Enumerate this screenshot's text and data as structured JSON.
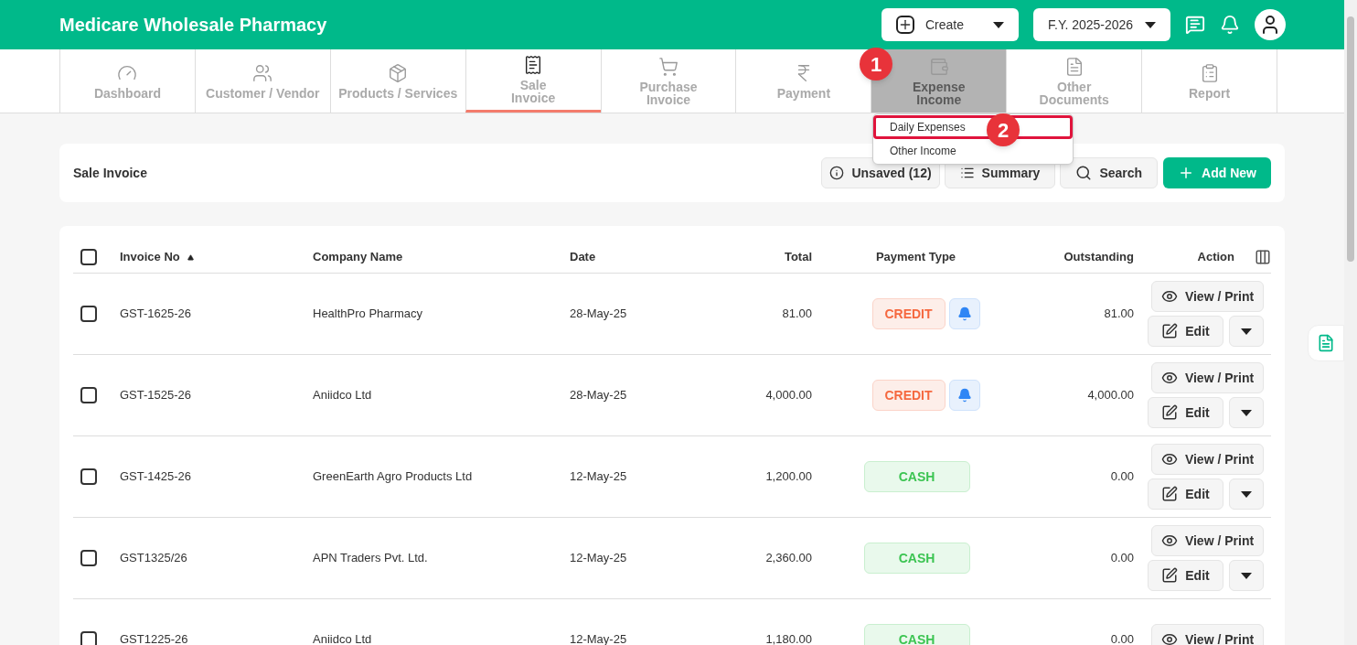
{
  "app_title": "Medicare Wholesale Pharmacy",
  "create_button": "Create",
  "fiscal_year": "F.Y. 2025-2026",
  "nav_tabs": [
    {
      "label": "Dashboard",
      "selected": false,
      "hovered": false
    },
    {
      "label": "Customer / Vendor",
      "selected": false,
      "hovered": false
    },
    {
      "label": "Products / Services",
      "selected": false,
      "hovered": false
    },
    {
      "label": "Sale\nInvoice",
      "selected": true,
      "hovered": false
    },
    {
      "label": "Purchase\nInvoice",
      "selected": false,
      "hovered": false
    },
    {
      "label": "Payment",
      "selected": false,
      "hovered": false
    },
    {
      "label": "Expense\nIncome",
      "selected": false,
      "hovered": true
    },
    {
      "label": "Other\nDocuments",
      "selected": false,
      "hovered": false
    },
    {
      "label": "Report",
      "selected": false,
      "hovered": false
    }
  ],
  "dropdown_menu": [
    {
      "label": "Daily Expenses",
      "highlighted": true
    },
    {
      "label": "Other Income",
      "highlighted": false
    }
  ],
  "callouts": [
    "1",
    "2"
  ],
  "page_title": "Sale Invoice",
  "toolbar": {
    "unsaved": "Unsaved (12)",
    "summary": "Summary",
    "search": "Search",
    "add_new": "Add New"
  },
  "table": {
    "select_all_checked": false,
    "columns": [
      "Invoice No",
      "Company Name",
      "Date",
      "Total",
      "Payment Type",
      "Outstanding",
      "Action"
    ],
    "rows": [
      {
        "checked": false,
        "invoice_no": "GST-1625-26",
        "company": "HealthPro Pharmacy",
        "date": "28-May-25",
        "total": "81.00",
        "payment_type": "CREDIT",
        "kind": "credit",
        "outstanding": "81.00",
        "view_label": "View / Print",
        "edit_label": "Edit"
      },
      {
        "checked": false,
        "invoice_no": "GST-1525-26",
        "company": "Aniidco Ltd",
        "date": "28-May-25",
        "total": "4,000.00",
        "payment_type": "CREDIT",
        "kind": "credit",
        "outstanding": "4,000.00",
        "view_label": "View / Print",
        "edit_label": "Edit"
      },
      {
        "checked": false,
        "invoice_no": "GST-1425-26",
        "company": "GreenEarth Agro Products Ltd",
        "date": "12-May-25",
        "total": "1,200.00",
        "payment_type": "CASH",
        "kind": "cash",
        "outstanding": "0.00",
        "view_label": "View / Print",
        "edit_label": "Edit"
      },
      {
        "checked": false,
        "invoice_no": "GST1325/26",
        "company": "APN Traders Pvt. Ltd.",
        "date": "12-May-25",
        "total": "2,360.00",
        "payment_type": "CASH",
        "kind": "cash",
        "outstanding": "0.00",
        "view_label": "View / Print",
        "edit_label": "Edit"
      },
      {
        "checked": false,
        "invoice_no": "GST1225-26",
        "company": "Aniidco Ltd",
        "date": "12-May-25",
        "total": "1,180.00",
        "payment_type": "CASH",
        "kind": "cash",
        "outstanding": "0.00",
        "view_label": "View / Print"
      }
    ]
  }
}
